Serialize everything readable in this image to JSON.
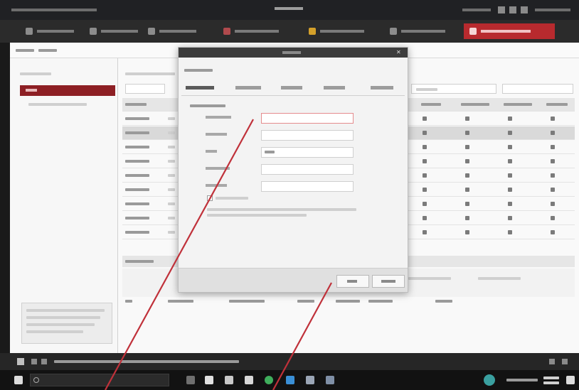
{
  "colors": {
    "accent": "#b82a2e",
    "selection": "#8d1f24",
    "annotation": "#c0313a"
  },
  "icons": {
    "window_controls": [
      "minimize-icon",
      "maximize-icon",
      "close-icon"
    ],
    "modules": [
      "home-icon",
      "device-icon",
      "camera-icon",
      "access-icon",
      "alarm-icon",
      "person-icon",
      "settings-icon"
    ],
    "modal_close": "close-icon"
  },
  "window": {
    "title": ""
  },
  "modules": [
    {
      "label": "",
      "active": false
    },
    {
      "label": "",
      "active": false
    },
    {
      "label": "",
      "active": false
    },
    {
      "label": "",
      "active": false
    },
    {
      "label": "",
      "active": false
    },
    {
      "label": "",
      "active": false
    },
    {
      "label": "",
      "active": true
    }
  ],
  "toolbar": {
    "items": [
      "",
      ""
    ]
  },
  "sidebar": {
    "title": "",
    "items": [
      {
        "label": "",
        "selected": true
      },
      {
        "label": "",
        "selected": false
      }
    ],
    "tip": ""
  },
  "table": {
    "header_value": "",
    "rows": [
      {
        "selected": false
      },
      {
        "selected": true
      },
      {
        "selected": false
      },
      {
        "selected": false
      },
      {
        "selected": false
      },
      {
        "selected": false
      },
      {
        "selected": false
      },
      {
        "selected": false
      },
      {
        "selected": false
      }
    ]
  },
  "dialog": {
    "title": "",
    "section_title": "",
    "tabs": [
      {
        "label": "",
        "active": true
      },
      {
        "label": "",
        "active": false
      },
      {
        "label": "",
        "active": false
      },
      {
        "label": "",
        "active": false
      },
      {
        "label": "",
        "active": false
      }
    ],
    "group_title": "",
    "fields": [
      {
        "label": "",
        "value": "",
        "focused": true
      },
      {
        "label": "",
        "value": "",
        "focused": false
      },
      {
        "label": "",
        "value": "",
        "focused": false
      },
      {
        "label": "",
        "value": "",
        "focused": false
      },
      {
        "label": "",
        "value": "",
        "focused": false
      }
    ],
    "checkbox_label": "",
    "note": "",
    "ok_label": "",
    "cancel_label": ""
  },
  "notification": {
    "text": ""
  },
  "taskbar": {
    "search_placeholder": "",
    "time": ""
  }
}
